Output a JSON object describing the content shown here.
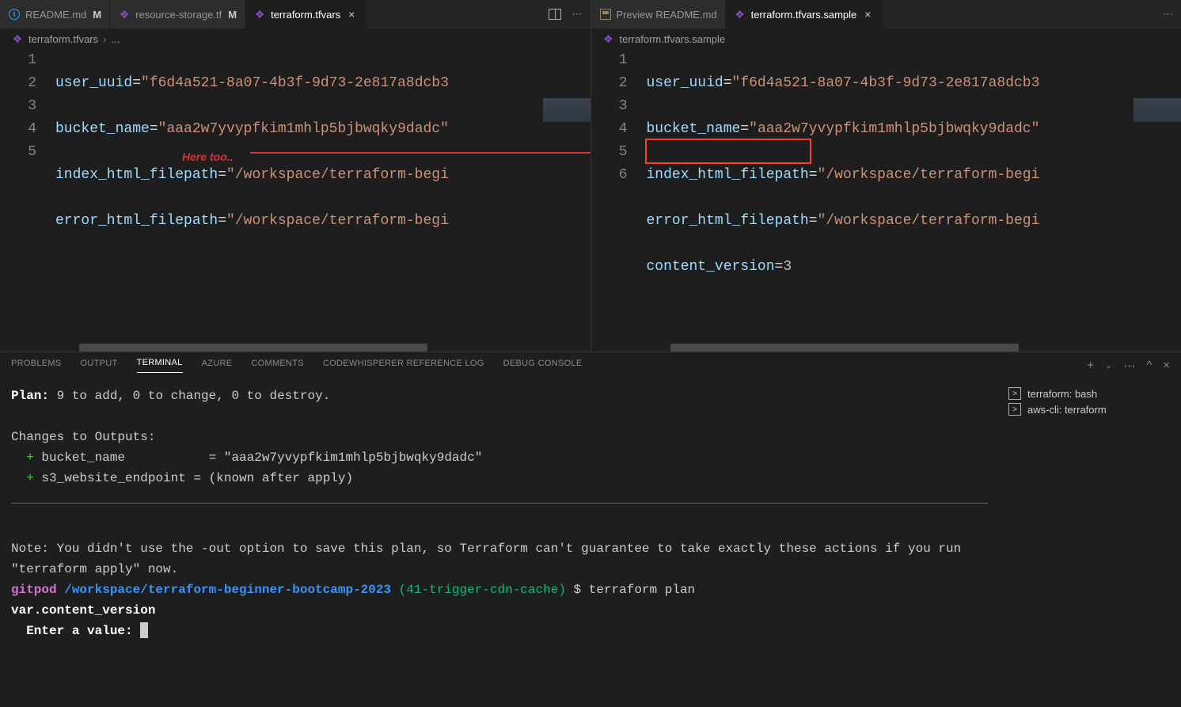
{
  "leftPane": {
    "tabs": [
      {
        "name": "README.md",
        "modified": "M",
        "iconType": "info"
      },
      {
        "name": "resource-storage.tf",
        "modified": "M",
        "iconType": "tf"
      },
      {
        "name": "terraform.tfvars",
        "active": true,
        "iconType": "tf"
      }
    ],
    "breadcrumb": {
      "file": "terraform.tfvars",
      "sep": "›",
      "rest": "..."
    },
    "lines": {
      "1": {
        "key": "user_uuid",
        "val": "\"f6d4a521-8a07-4b3f-9d73-2e817a8dcb3"
      },
      "2": {
        "key": "bucket_name",
        "val": "\"aaa2w7yvypfkim1mhlp5bjbwqky9dadc\""
      },
      "3": {
        "key": "index_html_filepath",
        "val": "\"/workspace/terraform-begi"
      },
      "4": {
        "key": "error_html_filepath",
        "val": "\"/workspace/terraform-begi"
      },
      "5": {
        "key": "",
        "val": ""
      }
    },
    "annotation": "Here too.."
  },
  "rightPane": {
    "tabs": [
      {
        "name": "Preview README.md",
        "iconType": "preview"
      },
      {
        "name": "terraform.tfvars.sample",
        "active": true,
        "iconType": "tf"
      }
    ],
    "breadcrumb": {
      "file": "terraform.tfvars.sample"
    },
    "lines": {
      "1": {
        "key": "user_uuid",
        "val": "\"f6d4a521-8a07-4b3f-9d73-2e817a8dcb3"
      },
      "2": {
        "key": "bucket_name",
        "val": "\"aaa2w7yvypfkim1mhlp5bjbwqky9dadc\""
      },
      "3": {
        "key": "index_html_filepath",
        "val": "\"/workspace/terraform-begi"
      },
      "4": {
        "key": "error_html_filepath",
        "val": "\"/workspace/terraform-begi"
      },
      "5": {
        "key": "content_version",
        "valNum": "3"
      },
      "6": {
        "key": "",
        "val": ""
      }
    }
  },
  "panel": {
    "tabs": [
      "PROBLEMS",
      "OUTPUT",
      "TERMINAL",
      "AZURE",
      "COMMENTS",
      "CODEWHISPERER REFERENCE LOG",
      "DEBUG CONSOLE"
    ],
    "activeTab": "TERMINAL",
    "terminals": [
      {
        "label": "terraform: bash"
      },
      {
        "label": "aws-cli: terraform"
      }
    ],
    "output": {
      "planLabel": "Plan:",
      "planText": " 9 to add, 0 to change, 0 to destroy.",
      "changesHeader": "Changes to Outputs:",
      "out1key": "bucket_name",
      "out1pad": "          ",
      "out1val": " = \"aaa2w7yvypfkim1mhlp5bjbwqky9dadc\"",
      "out2key": "s3_website_endpoint",
      "out2val": " = (known after apply)",
      "note": "Note: You didn't use the -out option to save this plan, so Terraform can't guarantee to take exactly these actions if you run \"terraform apply\" now.",
      "promptHost": "gitpod",
      "promptPath": " /workspace/terraform-beginner-bootcamp-2023",
      "promptBranch": " (41-trigger-cdn-cache)",
      "promptEnd": " $ ",
      "promptCmd": "terraform plan",
      "varLine": "var.content_version",
      "enterPrompt": "  Enter a value: "
    }
  }
}
